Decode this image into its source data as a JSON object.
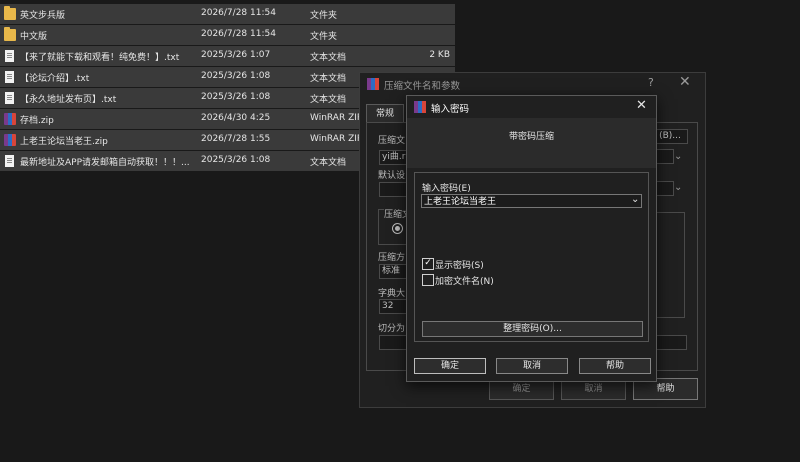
{
  "files": [
    {
      "name": "英文步兵版",
      "date": "2026/7/28 11:54",
      "type": "文件夹",
      "size": "",
      "icon": "folder-icon"
    },
    {
      "name": "中文版",
      "date": "2026/7/28 11:54",
      "type": "文件夹",
      "size": "",
      "icon": "folder-icon"
    },
    {
      "name": "【来了就能下载和观看！纯免费！】.txt",
      "date": "2025/3/26 1:07",
      "type": "文本文档",
      "size": "2 KB",
      "icon": "text-file-icon"
    },
    {
      "name": "【论坛介绍】.txt",
      "date": "2025/3/26 1:08",
      "type": "文本文档",
      "size": "",
      "icon": "text-file-icon"
    },
    {
      "name": "【永久地址发布页】.txt",
      "date": "2025/3/26 1:08",
      "type": "文本文档",
      "size": "",
      "icon": "text-file-icon"
    },
    {
      "name": "存档.zip",
      "date": "2026/4/30 4:25",
      "type": "WinRAR ZIP",
      "size": "",
      "icon": "winrar-zip-icon"
    },
    {
      "name": "上老王论坛当老王.zip",
      "date": "2026/7/28 1:55",
      "type": "WinRAR ZIP",
      "size": "",
      "icon": "winrar-zip-icon"
    },
    {
      "name": "最新地址及APP请发邮箱自动获取！！！...",
      "date": "2025/3/26 1:08",
      "type": "文本文档",
      "size": "",
      "icon": "text-file-icon"
    }
  ],
  "archive_dialog": {
    "title": "压缩文件名和参数",
    "help": "?",
    "close": "✕",
    "tab": "常规",
    "archive_label": "压缩文",
    "archive_value": "yi曲.ra",
    "browse": "(B)...",
    "default_label": "默认设",
    "format_label": "压缩文",
    "method_label": "压缩方",
    "method_value": "标准",
    "dict_label": "字典大",
    "dict_value": "32",
    "split_label": "切分为",
    "ok": "确定",
    "cancel": "取消",
    "help_btn": "帮助"
  },
  "password_dialog": {
    "title": "输入密码",
    "close": "✕",
    "header": "带密码压缩",
    "password_label": "输入密码(E)",
    "password_value": "上老王论坛当老王",
    "show_password_label": "显示密码(S)",
    "show_password_checked": true,
    "encrypt_names_label": "加密文件名(N)",
    "encrypt_names_checked": false,
    "manage_button": "整理密码(O)...",
    "ok": "确定",
    "cancel": "取消",
    "help": "帮助"
  }
}
